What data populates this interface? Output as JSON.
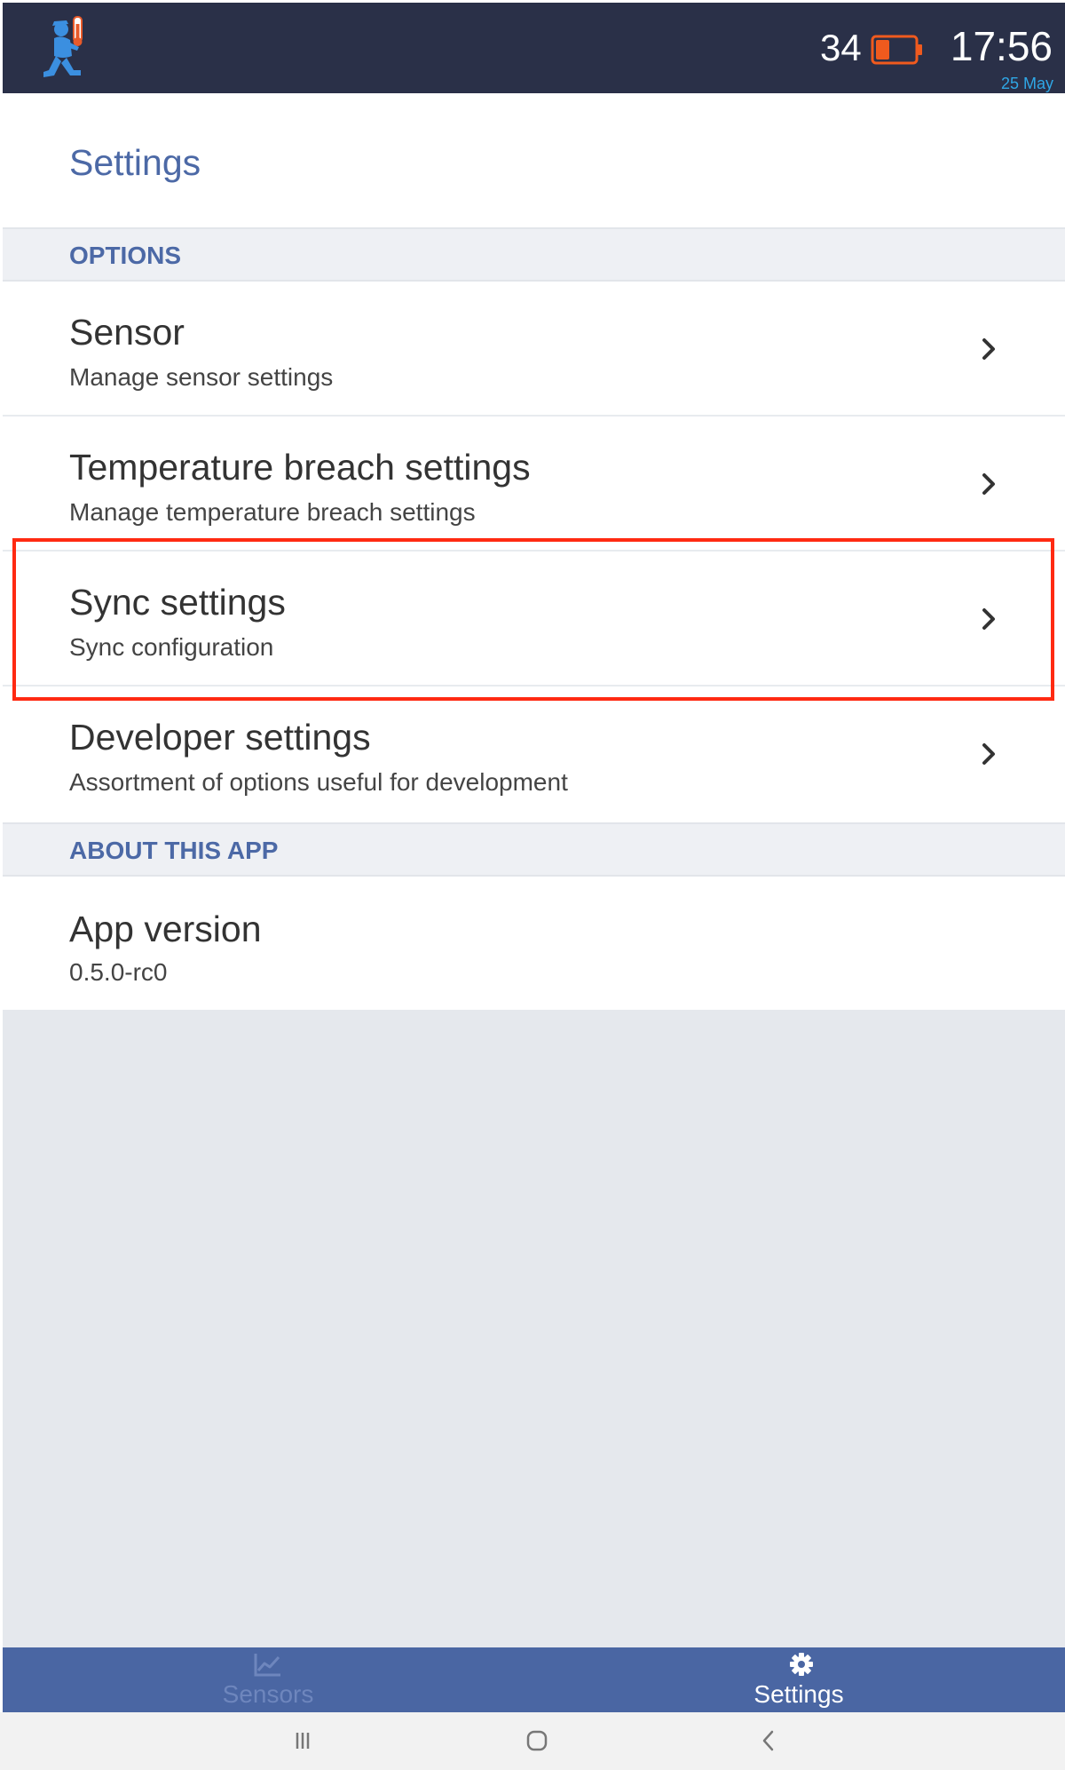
{
  "status_bar": {
    "logo_icon": "mascot-thermometer-icon",
    "battery_level": "34",
    "battery_icon": "battery-low-icon",
    "time": "17:56",
    "date": "25 May"
  },
  "header": {
    "title": "Settings"
  },
  "sections": {
    "options": {
      "heading": "OPTIONS",
      "items": [
        {
          "title": "Sensor",
          "subtitle": "Manage sensor settings",
          "icon": "chevron-right-icon"
        },
        {
          "title": "Temperature breach settings",
          "subtitle": "Manage temperature breach settings",
          "icon": "chevron-right-icon"
        },
        {
          "title": "Sync settings",
          "subtitle": "Sync configuration",
          "icon": "chevron-right-icon",
          "highlighted": true
        },
        {
          "title": "Developer settings",
          "subtitle": "Assortment of options useful for development",
          "icon": "chevron-right-icon"
        }
      ]
    },
    "about": {
      "heading": "ABOUT THIS APP",
      "items": [
        {
          "title": "App version",
          "subtitle": "0.5.0-rc0"
        }
      ]
    }
  },
  "bottom_nav": {
    "tabs": [
      {
        "label": "Sensors",
        "icon": "chart-icon",
        "active": false
      },
      {
        "label": "Settings",
        "icon": "gear-icon",
        "active": true
      }
    ]
  },
  "system_nav": {
    "buttons": [
      "recent-apps-icon",
      "home-icon",
      "back-icon"
    ]
  },
  "colors": {
    "topbar": "#2a3048",
    "accent": "#4c69a6",
    "nav_bar": "#4a66a3",
    "highlight": "#ff2a12",
    "battery": "#f05a1e",
    "date": "#2fa7e6"
  }
}
